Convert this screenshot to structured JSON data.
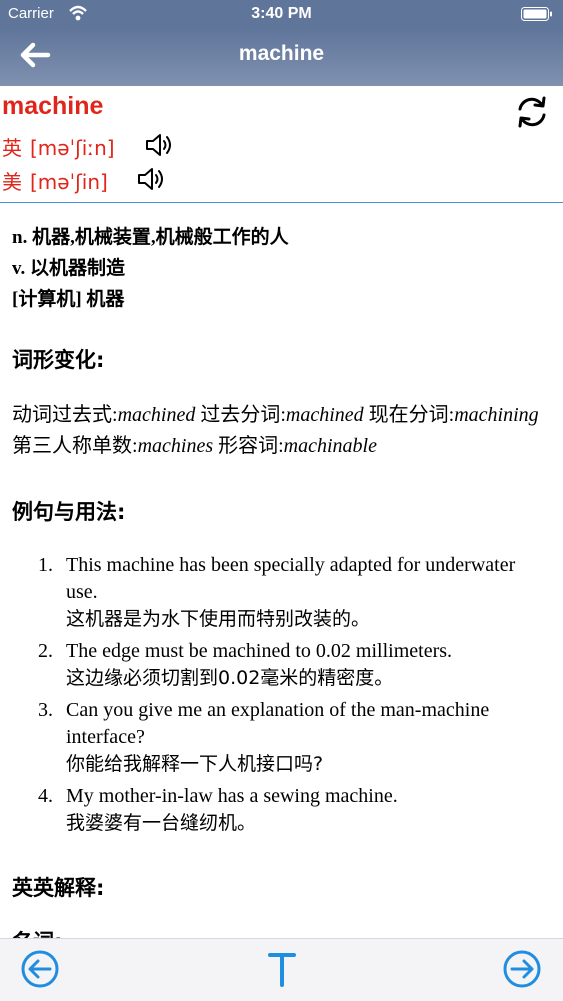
{
  "status_bar": {
    "carrier": "Carrier",
    "time": "3:40 PM"
  },
  "nav": {
    "title": "machine"
  },
  "word": {
    "headword": "machine",
    "uk_label": "英",
    "uk_ipa": "[məˈʃiːn]",
    "us_label": "美",
    "us_ipa": "[məˈʃin]"
  },
  "definitions": [
    "n. 机器,机械装置,机械般工作的人",
    "v. 以机器制造",
    "[计算机] 机器"
  ],
  "sections": {
    "forms_title": "词形变化:",
    "examples_title": "例句与用法:",
    "en_title": "英英解释:",
    "cutoff": "名词:"
  },
  "forms": {
    "past_label": "动词过去式:",
    "past": "machined",
    "pp_label": " 过去分词:",
    "pp": "machined",
    "pres_label": " 现在分词:",
    "pres": "machining",
    "third_label": " 第三人称单数:",
    "third": "machines",
    "adj_label": " 形容词:",
    "adj": "machinable"
  },
  "examples": [
    {
      "num": "1.",
      "en": "This machine has been specially adapted for underwater use.",
      "zh": "这机器是为水下使用而特别改装的。"
    },
    {
      "num": "2.",
      "en": "The edge must be machined to 0.02 millimeters.",
      "zh": "这边缘必须切割到0.02毫米的精密度。"
    },
    {
      "num": "3.",
      "en": "Can you give me an explanation of the man-machine interface?",
      "zh": "你能给我解释一下人机接口吗?"
    },
    {
      "num": "4.",
      "en": "My mother-in-law has a sewing machine.",
      "zh": "我婆婆有一台缝纫机。"
    }
  ],
  "colors": {
    "nav": "#5f759a",
    "accent": "#e0261b",
    "toolbar_icon": "#1f8ee0"
  },
  "icons": {
    "back": "arrow-left-icon",
    "refresh": "refresh-icon",
    "speaker": "speaker-icon",
    "prev": "circle-arrow-left-icon",
    "font": "text-t-icon",
    "next": "circle-arrow-right-icon"
  }
}
